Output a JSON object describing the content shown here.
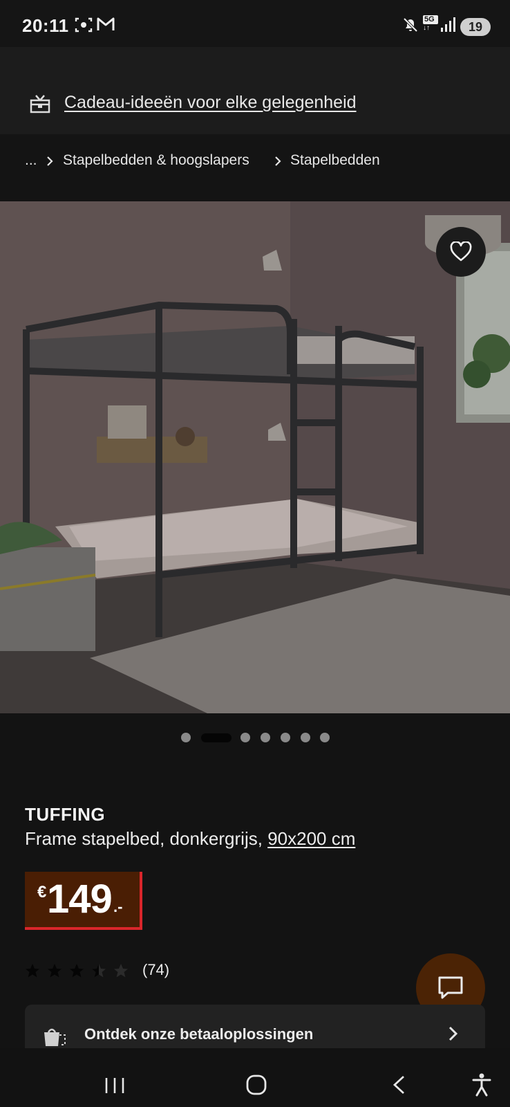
{
  "status_bar": {
    "time": "20:11",
    "network": "5G",
    "notification_count": "19",
    "icons": [
      "screenshot-icon",
      "gmail-icon",
      "mute-icon",
      "5g-data-icon",
      "signal-icon"
    ]
  },
  "promo": {
    "icon": "gift-box-icon",
    "link_text": "Cadeau-ideeën voor elke gelegenheid"
  },
  "breadcrumb": {
    "items": [
      "...",
      "Stapelbedden & hoogslapers",
      "Stapelbedden"
    ]
  },
  "gallery": {
    "total_images": 7,
    "active_index": 1,
    "favorite_icon": "heart-icon"
  },
  "product": {
    "name": "TUFFING",
    "description": "Frame stapelbed, donkergrijs,",
    "size": "90x200 cm",
    "price": {
      "currency": "€",
      "integer": "149",
      "decimal": ".-"
    },
    "rating": {
      "value": 3.5,
      "max": 5,
      "count_label": "(74)"
    }
  },
  "payment": {
    "icon": "shopping-bag-icon",
    "label": "Ontdek onze betaaloplossingen",
    "chevron": "chevron-right-icon"
  },
  "chat": {
    "icon": "chat-icon"
  },
  "colors": {
    "price_bg": "#4a1e04",
    "price_accent": "#d9262b",
    "chat_bg": "#4b2305",
    "page_bg": "#131313"
  },
  "nav_bar": {
    "icons": [
      "recent-apps-icon",
      "home-icon",
      "back-icon",
      "accessibility-icon"
    ]
  }
}
